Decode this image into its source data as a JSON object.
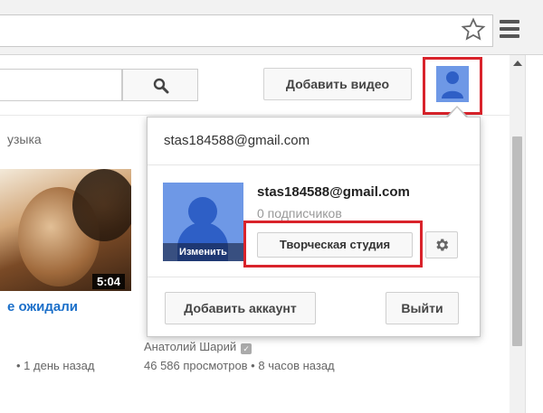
{
  "browser": {
    "star_icon": "star-icon",
    "menu_icon": "hamburger-menu-icon"
  },
  "masthead": {
    "search_placeholder": "",
    "upload_label": "Добавить видео"
  },
  "guide": {
    "category": "узыка"
  },
  "videos": [
    {
      "title": "е ожидали",
      "duration": "5:04",
      "meta": "• 1 день назад"
    },
    {
      "channel": "Анатолий Шарий",
      "meta": "46 586 просмотров • 8 часов назад"
    }
  ],
  "account_menu": {
    "email_header": "stas184588@gmail.com",
    "display_name": "stas184588@gmail.com",
    "subscribers": "0 подписчиков",
    "change_label": "Изменить",
    "studio_label": "Творческая студия",
    "add_account_label": "Добавить аккаунт",
    "logout_label": "Выйти"
  },
  "colors": {
    "highlight": "#d9232b",
    "avatar_bg": "#6e98e6",
    "link": "#1b6fc9"
  }
}
